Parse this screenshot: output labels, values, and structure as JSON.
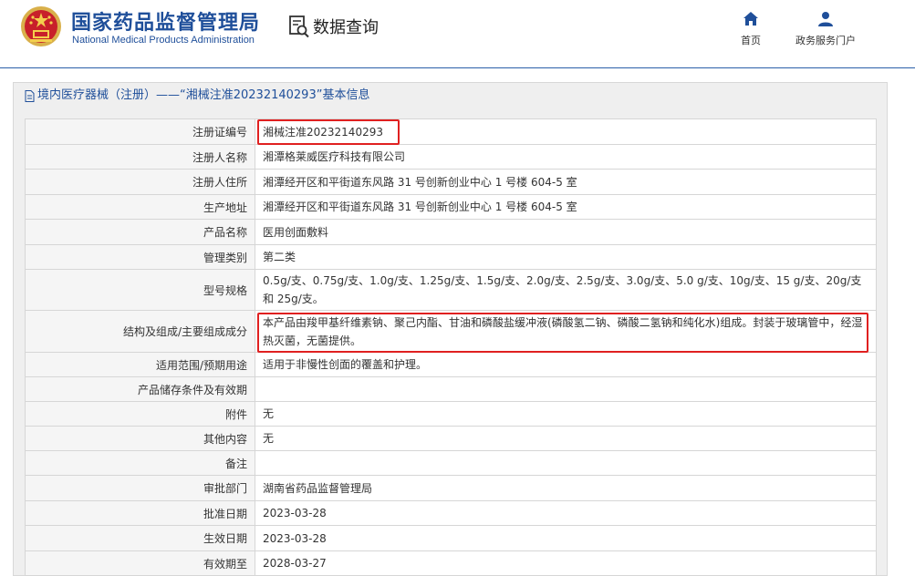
{
  "header": {
    "brand_cn": "国家药品监督管理局",
    "brand_en": "National Medical Products Administration",
    "query_label": "数据查询",
    "nav": [
      {
        "label": "首页",
        "icon": "home-icon"
      },
      {
        "label": "政务服务门户",
        "icon": "user-icon"
      }
    ]
  },
  "panel": {
    "title": "境内医疗器械（注册）——“湘械注准20232140293”基本信息"
  },
  "rows": [
    {
      "label": "注册证编号",
      "value": "湘械注准20232140293"
    },
    {
      "label": "注册人名称",
      "value": "湘潭格莱威医疗科技有限公司"
    },
    {
      "label": "注册人住所",
      "value": "湘潭经开区和平街道东风路 31 号创新创业中心 1 号楼 604-5 室"
    },
    {
      "label": "生产地址",
      "value": "湘潭经开区和平街道东风路 31 号创新创业中心 1 号楼 604-5 室"
    },
    {
      "label": "产品名称",
      "value": "医用创面敷料"
    },
    {
      "label": "管理类别",
      "value": "第二类"
    },
    {
      "label": "型号规格",
      "value": "0.5g/支、0.75g/支、1.0g/支、1.25g/支、1.5g/支、2.0g/支、2.5g/支、3.0g/支、5.0 g/支、10g/支、15 g/支、20g/支和 25g/支。"
    },
    {
      "label": "结构及组成/主要组成成分",
      "value": "本产品由羧甲基纤维素钠、聚己内酯、甘油和磷酸盐缓冲液(磷酸氢二钠、磷酸二氢钠和纯化水)组成。封装于玻璃管中，经湿热灭菌，无菌提供。"
    },
    {
      "label": "适用范围/预期用途",
      "value": "适用于非慢性创面的覆盖和护理。"
    },
    {
      "label": "产品储存条件及有效期",
      "value": ""
    },
    {
      "label": "附件",
      "value": "无"
    },
    {
      "label": "其他内容",
      "value": "无"
    },
    {
      "label": "备注",
      "value": ""
    },
    {
      "label": "审批部门",
      "value": "湖南省药品监督管理局"
    },
    {
      "label": "批准日期",
      "value": "2023-03-28"
    },
    {
      "label": "生效日期",
      "value": "2023-03-28"
    },
    {
      "label": "有效期至",
      "value": "2028-03-27"
    }
  ],
  "colors": {
    "brand": "#1f4f9a",
    "highlight": "#e02020"
  }
}
